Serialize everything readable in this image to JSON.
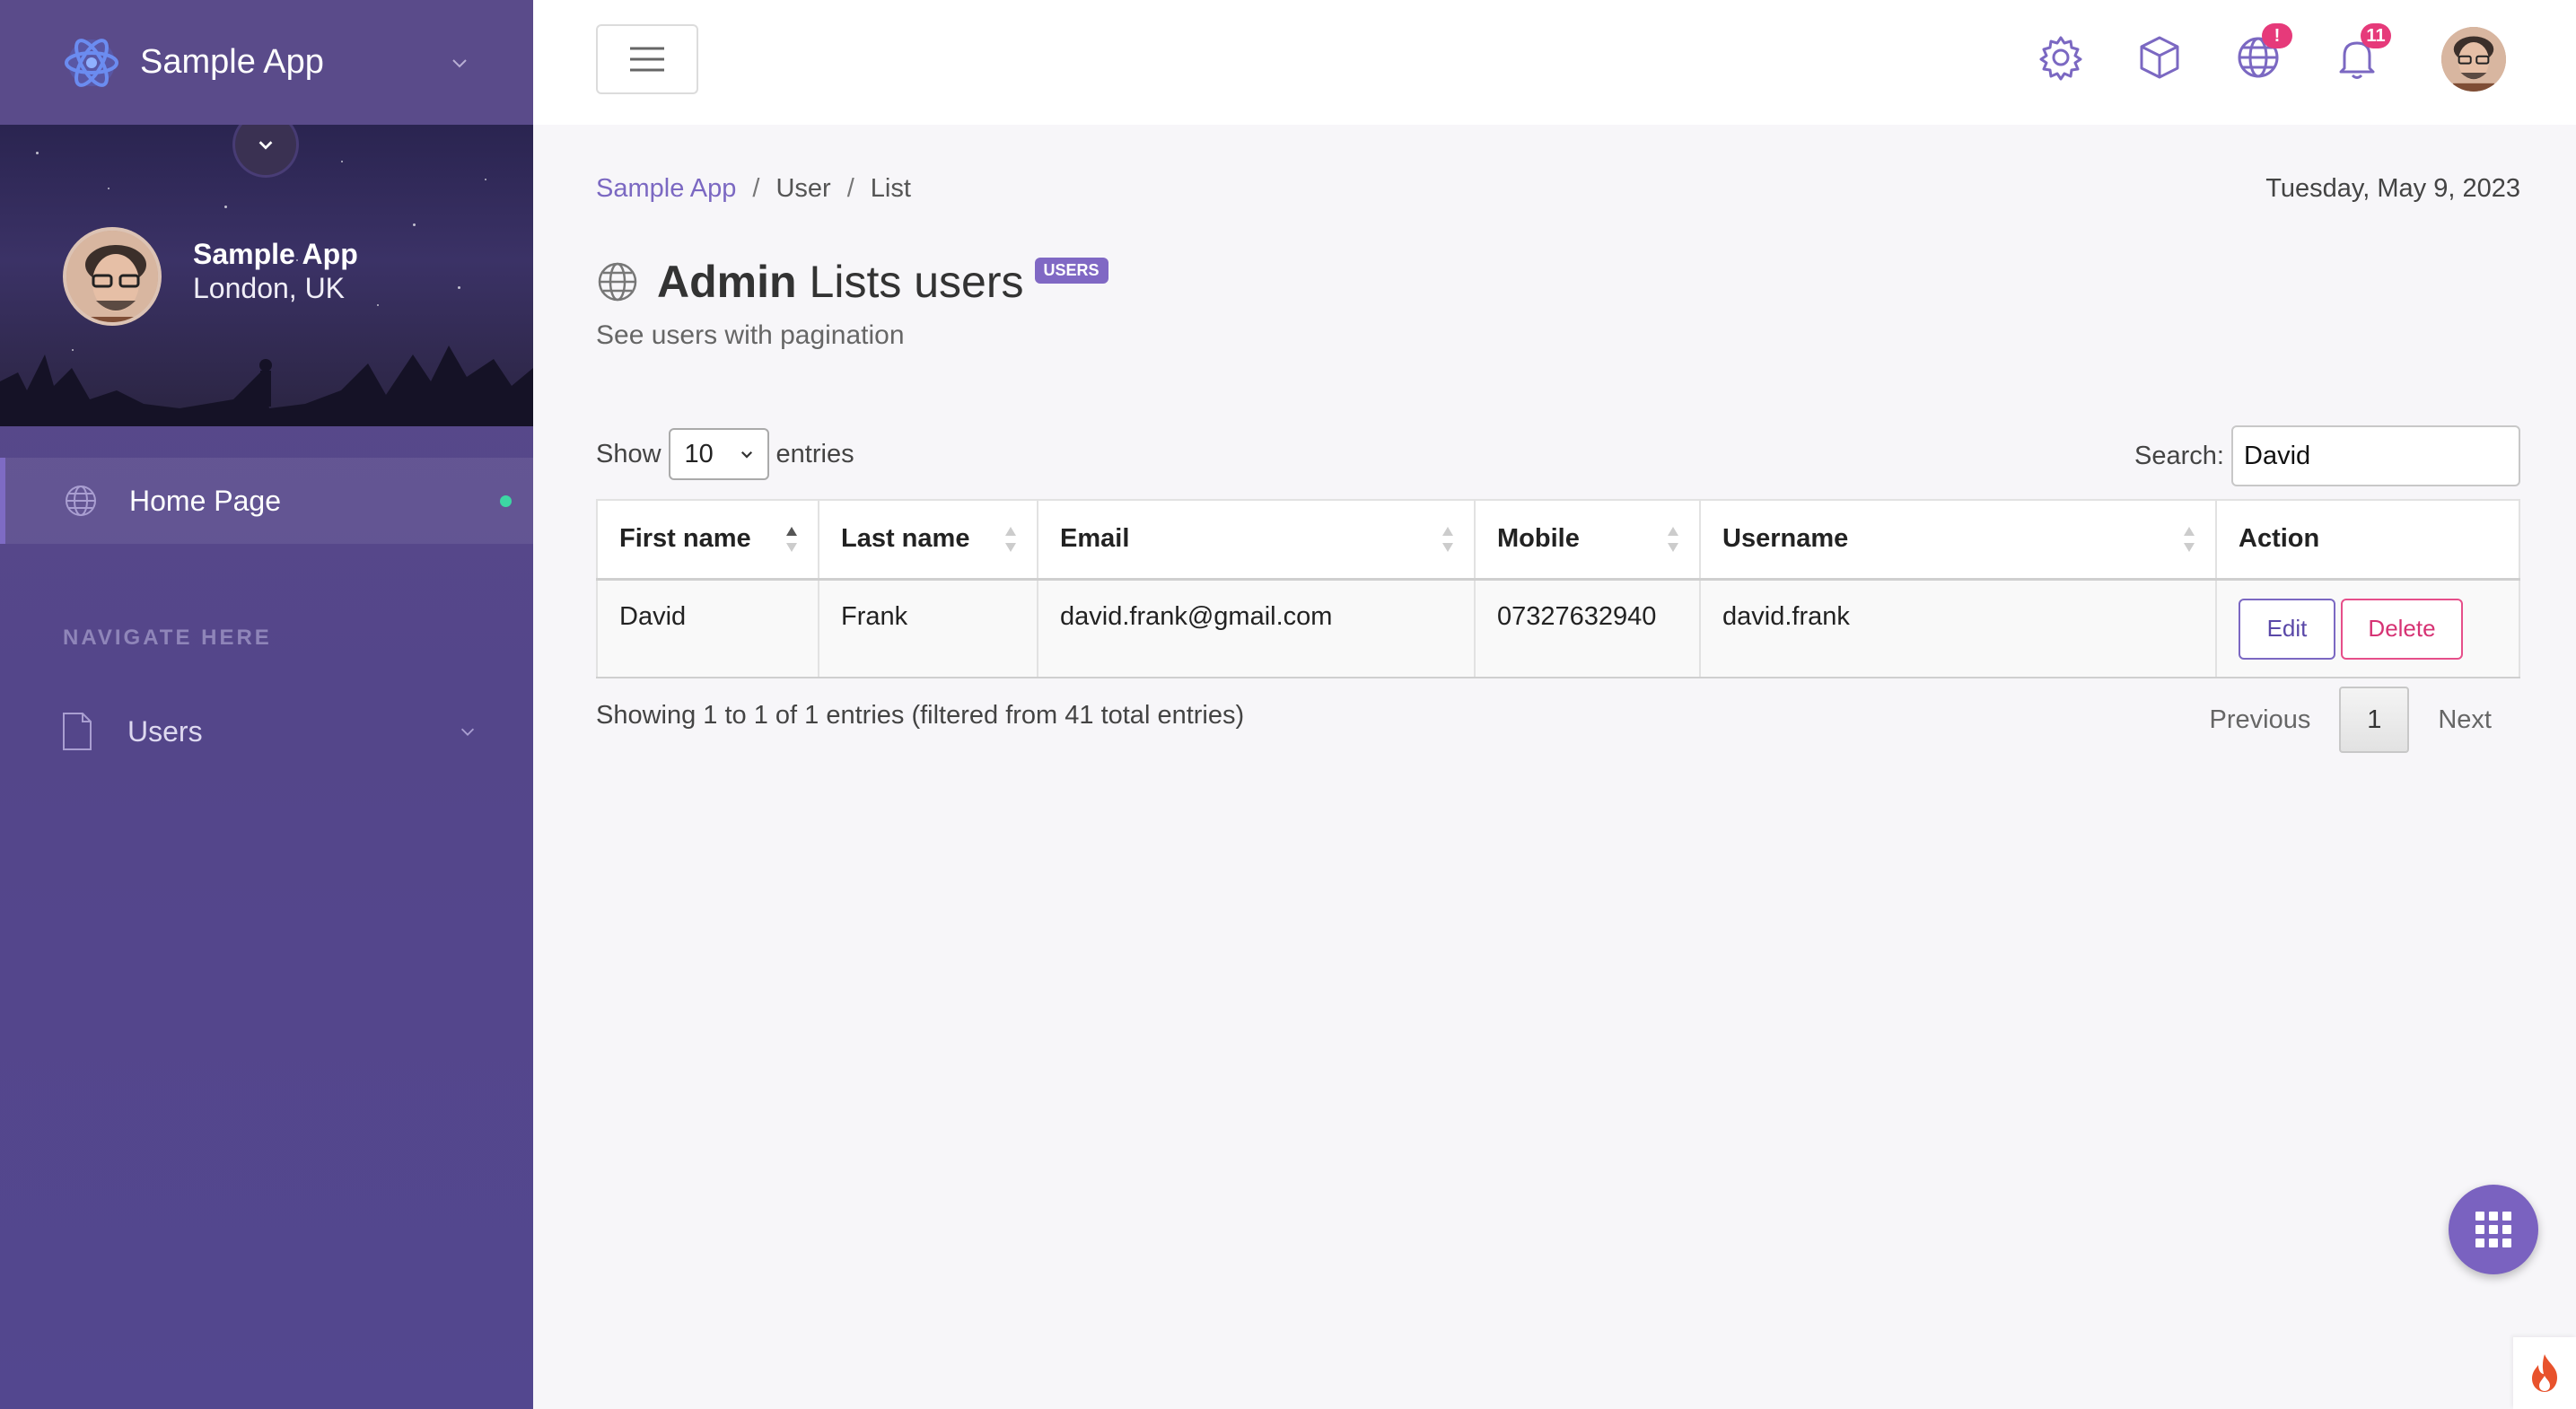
{
  "sidebar": {
    "brand_name": "Sample App",
    "profile": {
      "name": "Sample App",
      "location": "London, UK"
    },
    "nav_home_label": "Home Page",
    "section_title": "NAVIGATE HERE",
    "nav_users_label": "Users"
  },
  "topbar": {
    "globe_badge": "!",
    "bell_badge": "11"
  },
  "breadcrumb": {
    "root": "Sample App",
    "level1": "User",
    "level2": "List"
  },
  "date": "Tuesday, May 9, 2023",
  "page_title": {
    "strong": "Admin",
    "rest": "Lists users",
    "badge": "USERS"
  },
  "subtitle": "See users with pagination",
  "table_controls": {
    "show_label": "Show",
    "page_size": "10",
    "entries_label": "entries",
    "search_label": "Search:",
    "search_value": "David"
  },
  "table": {
    "headers": [
      "First name",
      "Last name",
      "Email",
      "Mobile",
      "Username",
      "Action"
    ],
    "rows": [
      {
        "first": "David",
        "last": "Frank",
        "email": "david.frank@gmail.com",
        "mobile": "07327632940",
        "username": "david.frank"
      }
    ],
    "edit_label": "Edit",
    "delete_label": "Delete"
  },
  "info_text": "Showing 1 to 1 of 1 entries (filtered from 41 total entries)",
  "pagination": {
    "previous": "Previous",
    "current": "1",
    "next": "Next"
  },
  "colors": {
    "accent": "#7b68c2",
    "sidebar": "#54468a",
    "danger": "#d63374",
    "online": "#3dd6a3"
  }
}
